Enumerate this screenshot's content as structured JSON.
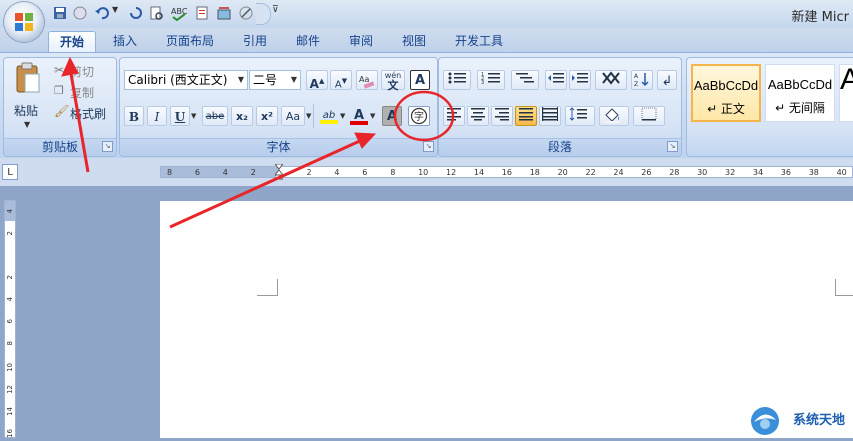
{
  "window": {
    "title": "新建 Micr"
  },
  "tabs": [
    {
      "label": "开始",
      "active": true
    },
    {
      "label": "插入"
    },
    {
      "label": "页面布局"
    },
    {
      "label": "引用"
    },
    {
      "label": "邮件"
    },
    {
      "label": "审阅"
    },
    {
      "label": "视图"
    },
    {
      "label": "开发工具"
    }
  ],
  "clipboard": {
    "paste_label": "粘贴",
    "cut_label": "剪切",
    "copy_label": "复制",
    "format_painter_label": "格式刷",
    "group_label": "剪贴板"
  },
  "font": {
    "font_name": "Calibri (西文正文)",
    "font_size": "二号",
    "group_label": "字体",
    "grow_label": "A",
    "shrink_label": "A",
    "phonetic_label": "wén",
    "border_char": "A",
    "bold": "B",
    "italic": "I",
    "underline": "U",
    "strike": "abe",
    "subscript": "x₂",
    "superscript": "x²",
    "case": "Aa",
    "highlight": "ab",
    "font_color": "A",
    "shade_char": "A",
    "enclose_char": "字"
  },
  "paragraph": {
    "group_label": "段落"
  },
  "styles": [
    {
      "sample": "AaBbCcDd",
      "name": "↵ 正文",
      "selected": true
    },
    {
      "sample": "AaBbCcDd",
      "name": "↵ 无间隔"
    },
    {
      "sample": "A",
      "name": ""
    }
  ],
  "ruler": {
    "h_labels": [
      "8",
      "6",
      "4",
      "2",
      "",
      "2",
      "4",
      "6",
      "8",
      "10",
      "12",
      "14",
      "16",
      "18",
      "20",
      "22",
      "24",
      "26",
      "28",
      "30",
      "32",
      "34",
      "36",
      "38",
      "40"
    ],
    "v_labels": [
      "4",
      "2",
      "",
      "2",
      "4",
      "6",
      "8",
      "10",
      "12",
      "14",
      "16"
    ]
  },
  "watermark": {
    "text": "系统天地"
  },
  "colors": {
    "annotation": "#e8262a",
    "accent": "#15428b"
  }
}
